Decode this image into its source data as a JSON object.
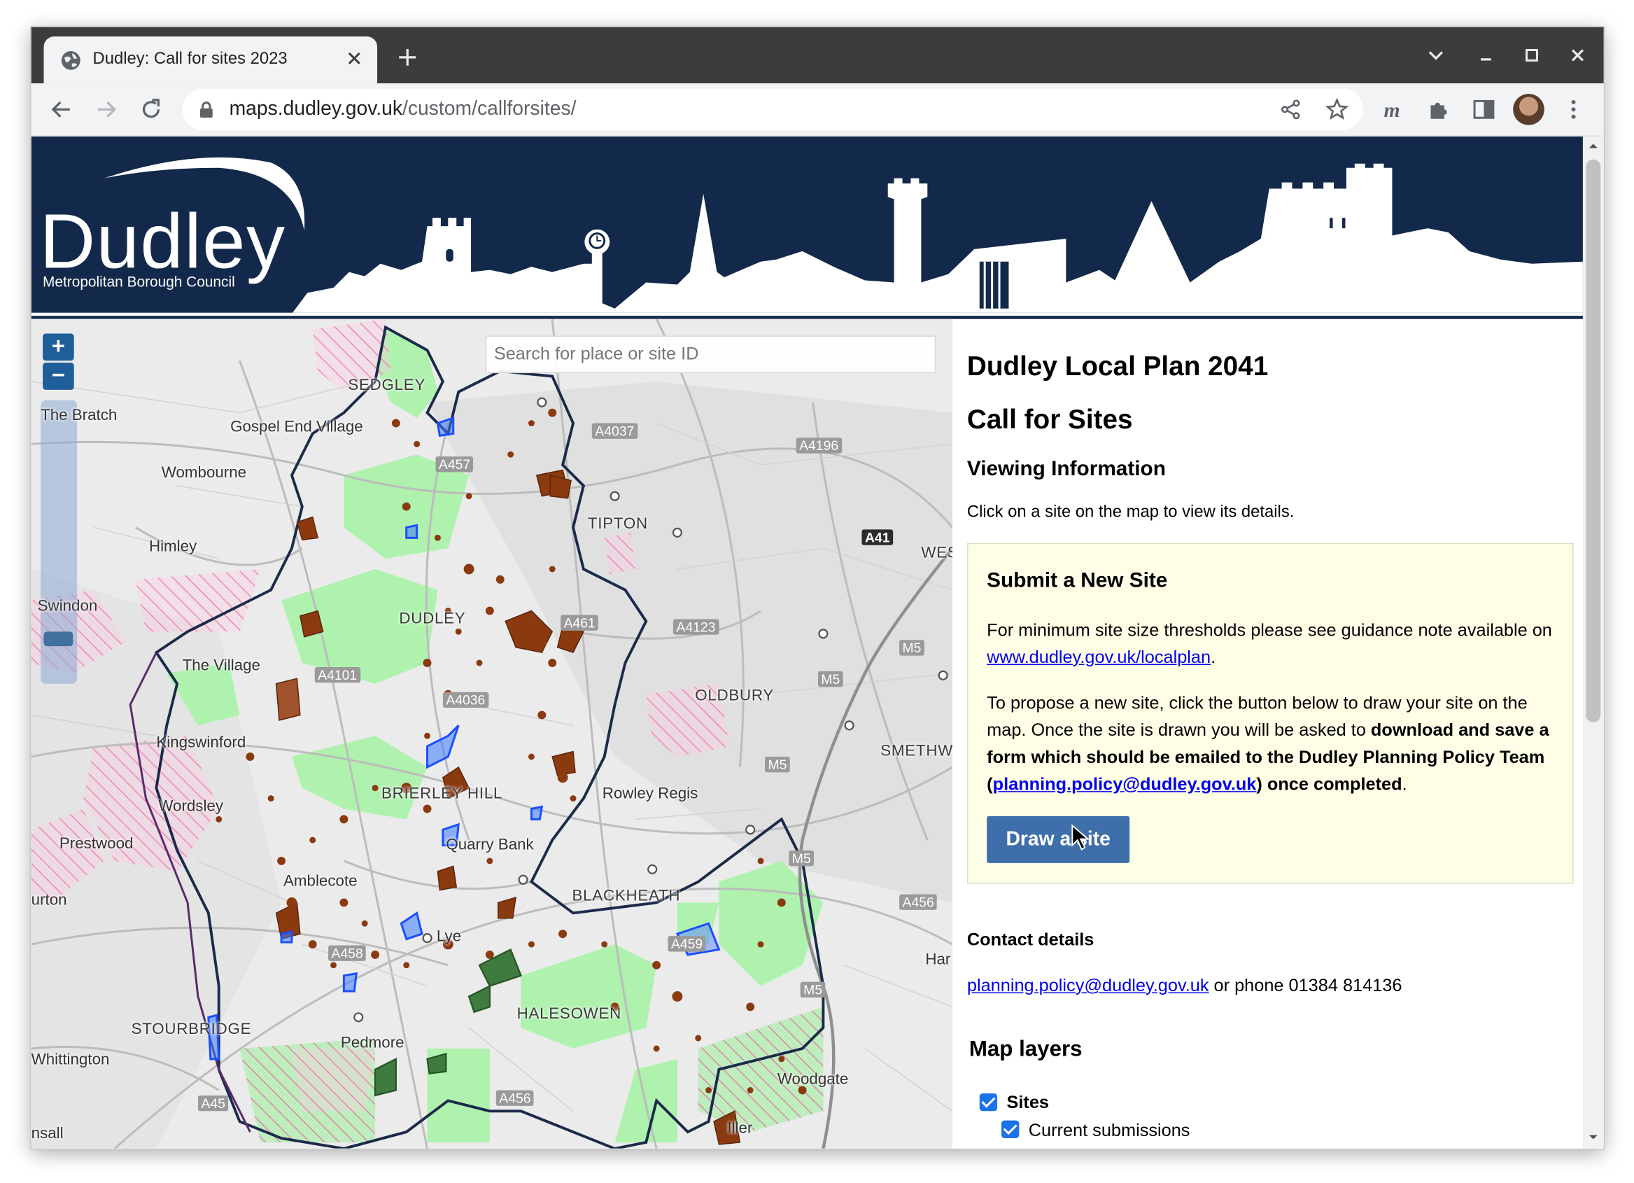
{
  "browser": {
    "tab_title": "Dudley: Call for sites 2023",
    "url_host": "maps.dudley.gov.uk",
    "url_path": "/custom/callforsites/"
  },
  "banner": {
    "logo_text": "Dudley",
    "logo_subtitle": "Metropolitan Borough Council"
  },
  "map": {
    "zoom_in": "+",
    "zoom_out": "−",
    "search_placeholder": "Search for place or site ID",
    "place_labels": [
      "The Bratch",
      "Gospel End Village",
      "SEDGLEY",
      "Wombourne",
      "Himley",
      "Swindon",
      "TIPTON",
      "DUDLEY",
      "The Village",
      "Kingswinford",
      "Wordsley",
      "Prestwood",
      "OLDBURY",
      "SMETHW",
      "BRIERLEY HILL",
      "Rowley Regis",
      "Quarry Bank",
      "Amblecote",
      "BLACKHEATH",
      "Lye",
      "HALESOWEN",
      "STOURBRIDGE",
      "Pedmore",
      "Whittington",
      "Woodgate",
      "urton",
      "nsall",
      "WES",
      "Har",
      "Iller"
    ],
    "road_labels": [
      "A4037",
      "A4196",
      "A457",
      "A41",
      "A461",
      "A4123",
      "A4101",
      "A4036",
      "M5",
      "A458",
      "A459",
      "A456",
      "A45"
    ]
  },
  "panel": {
    "title": "Dudley Local Plan 2041",
    "subtitle": "Call for Sites",
    "viewing_heading": "Viewing Information",
    "viewing_text": "Click on a site on the map to view its details.",
    "submit_heading": "Submit a New Site",
    "submit_p1_before": "For minimum site size thresholds please see guidance note available on ",
    "submit_p1_link": "www.dudley.gov.uk/localplan",
    "submit_p1_after": ".",
    "submit_p2_before": "To propose a new site, click the button below to draw your site on the map. Once the site is drawn you will be asked to ",
    "submit_p2_bold": "download and save a form which should be emailed to the Dudley Planning Policy Team (",
    "submit_p2_link": "planning.policy@dudley.gov.uk",
    "submit_p2_bold_end": ") once completed",
    "submit_p2_end": ".",
    "draw_button": "Draw a site",
    "contact_heading": "Contact details",
    "contact_email": "planning.policy@dudley.gov.uk",
    "contact_phone_text": " or phone 01384 814136",
    "layers_heading": "Map layers",
    "layer_sites": "Sites",
    "layer_current": "Current submissions"
  },
  "colors": {
    "banner_navy": "#13294b",
    "button_blue": "#3f6faa",
    "submit_box_bg": "#fefde5",
    "boundary": "#1b2a4a",
    "green_belt": "#a8f0a8",
    "site_brown": "#8b3a10"
  }
}
